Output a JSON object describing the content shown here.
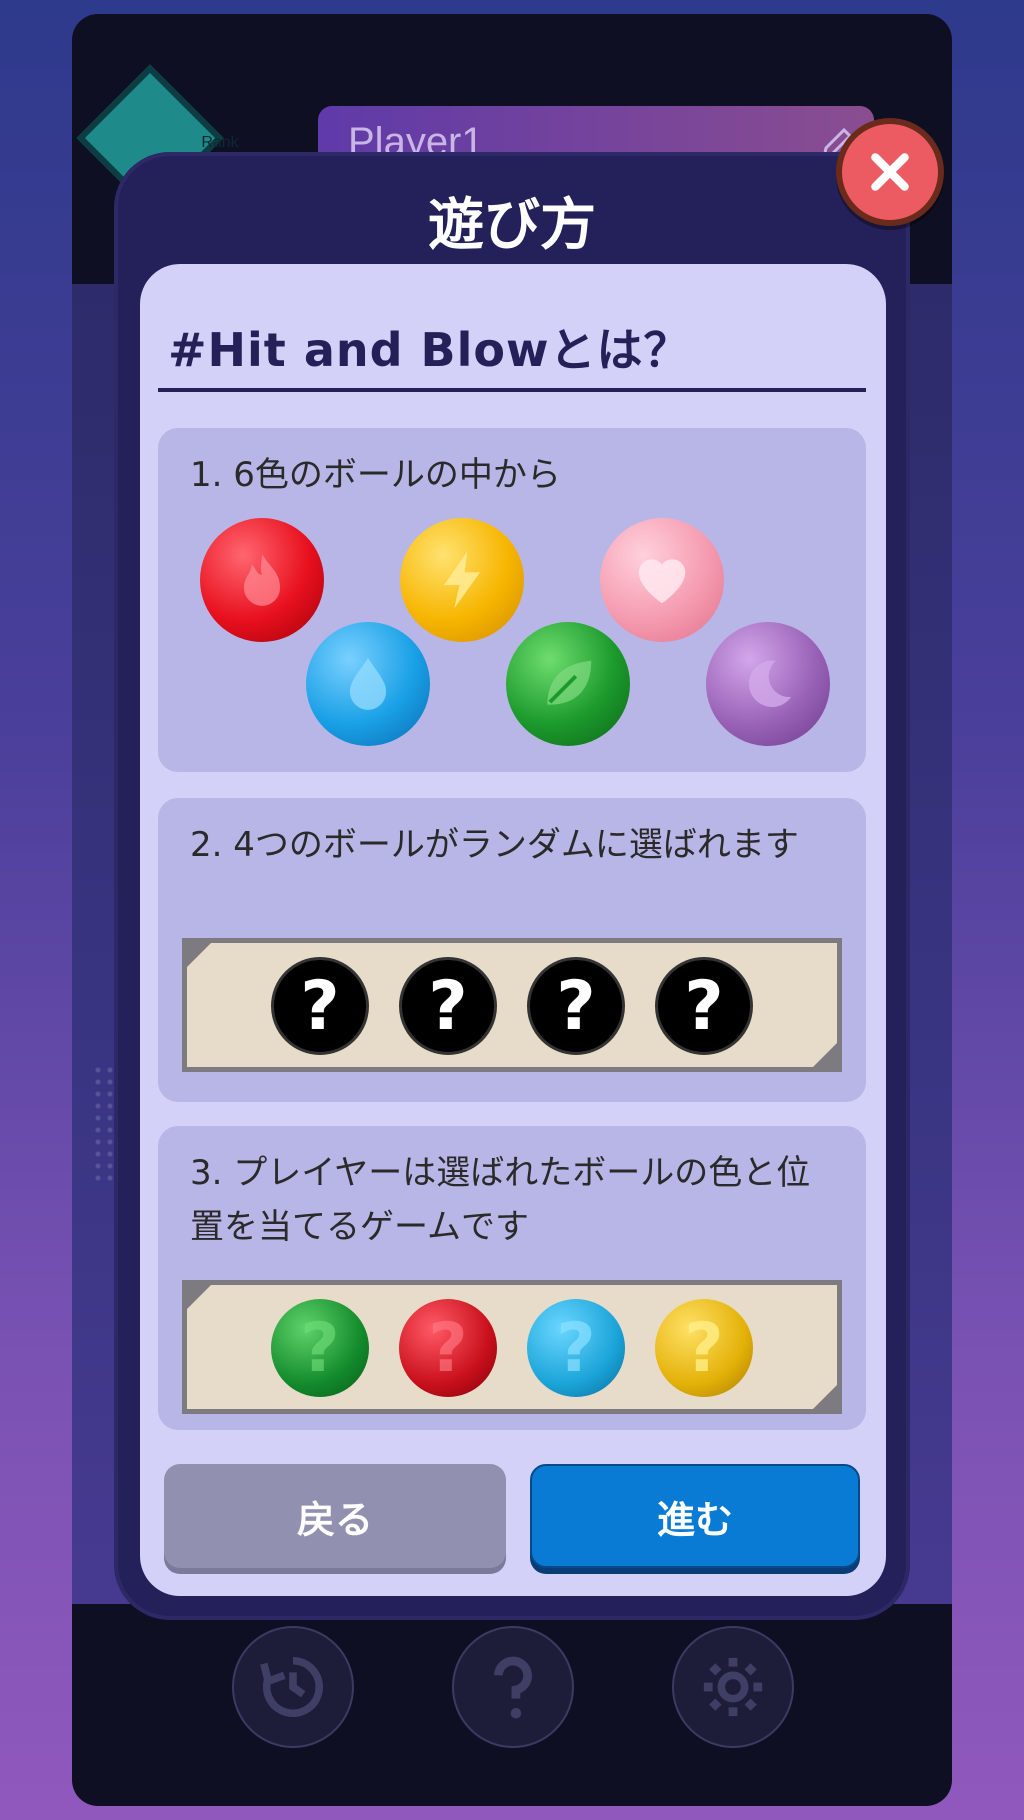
{
  "background_app": {
    "rank_label": "Rank",
    "player_name": "Player1",
    "edit_icon": "pencil-icon",
    "nav_icons": [
      "history-icon",
      "help-icon",
      "settings-icon"
    ]
  },
  "modal": {
    "title": "遊び方",
    "close_icon": "close-icon",
    "section_heading": "#Hit and Blowとは？",
    "steps": [
      {
        "text": "1. 6色のボールの中から"
      },
      {
        "text": "2. 4つのボールがランダムに選ばれます"
      },
      {
        "text": "3. プレイヤーは選ばれたボールの色と位置を当てるゲームです"
      }
    ],
    "ball_colors": [
      {
        "name": "red",
        "icon": "flame-icon",
        "color": "#e8101e"
      },
      {
        "name": "blue",
        "icon": "droplet-icon",
        "color": "#1aa0e6"
      },
      {
        "name": "yellow",
        "icon": "lightning-icon",
        "color": "#f7b500"
      },
      {
        "name": "green",
        "icon": "leaf-icon",
        "color": "#1c9a2c"
      },
      {
        "name": "pink",
        "icon": "heart-icon",
        "color": "#f59bb0"
      },
      {
        "name": "purple",
        "icon": "moon-icon",
        "color": "#9a63b8"
      }
    ],
    "hidden_slot_glyph": "?",
    "guess_colors": [
      "#138a2c",
      "#c8101c",
      "#1ba4d8",
      "#e3b108"
    ],
    "back_label": "戻る",
    "next_label": "進む"
  }
}
